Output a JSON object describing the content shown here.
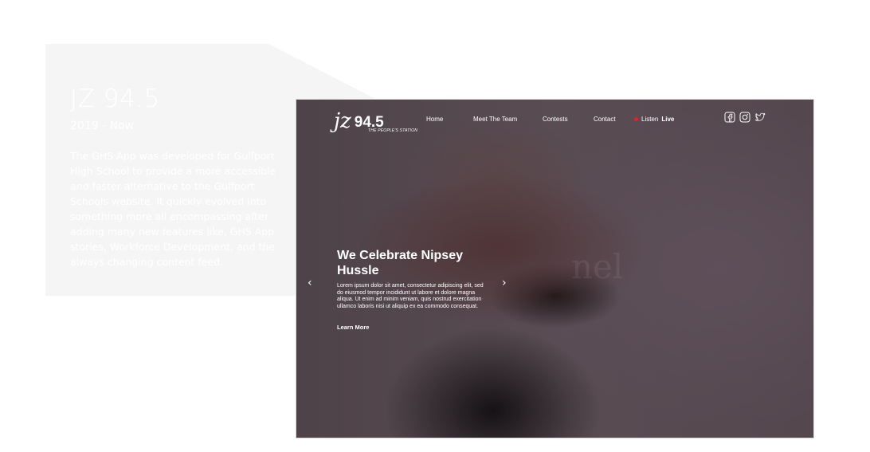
{
  "project": {
    "title": "JZ 94.5",
    "date": "2019 - Now",
    "description": "The GHS App was developed for Gulfport High School to provide a more accessible and faster alternative to the Gulfport Schools website. It quickly evolved into something more all encompassing after adding many new features like, GHS App stories, Workforce Development, and the always changing content feed."
  },
  "site": {
    "logo": {
      "script": "jz",
      "frequency": "94.5",
      "tagline": "THE PEOPLE'S STATION"
    },
    "nav": {
      "home": "Home",
      "team": "Meet The Team",
      "contests": "Contests",
      "contact": "Contact",
      "listen_prefix": "Listen",
      "listen_live": "Live"
    },
    "socials": [
      "facebook-icon",
      "instagram-icon",
      "twitter-icon"
    ],
    "hero": {
      "title": "We Celebrate Nipsey Hussle",
      "body": "Lorem ipsum dolor sit amet, consectetur adipiscing elit, sed do eiusmod tempor incididunt ut labore et dolore magna aliqua. Ut enim ad minim veniam, quis nostrud exercitation ullamco laboris nisi ut aliquip ex ea commodo consequat.",
      "link": "Learn More",
      "prev_arrow": "‹",
      "next_arrow": "›"
    },
    "colors": {
      "live_dot": "#e02424",
      "card_bg": "#f5f5f5"
    }
  }
}
